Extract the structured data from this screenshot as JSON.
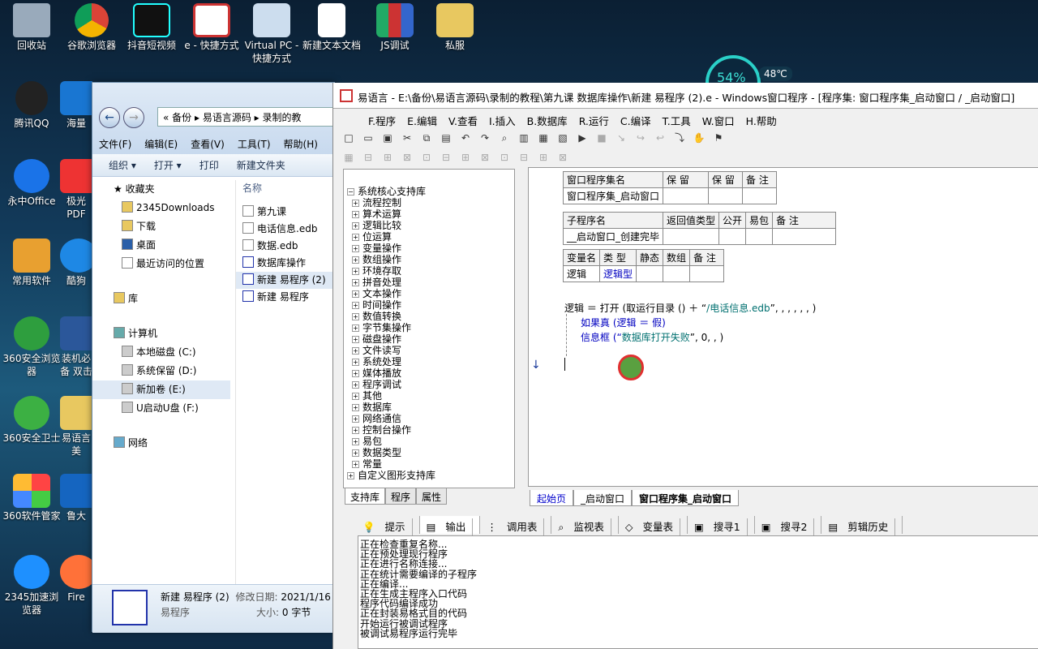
{
  "desktop": {
    "icons": [
      {
        "label": "回收站",
        "icon": "recycle-bin"
      },
      {
        "label": "谷歌浏览器",
        "icon": "chrome"
      },
      {
        "label": "抖音短视频",
        "icon": "douyin"
      },
      {
        "label": "e - 快捷方式",
        "icon": "e-lang"
      },
      {
        "label": "Virtual PC - 快捷方式",
        "icon": "virtual-pc"
      },
      {
        "label": "新建文本文档",
        "icon": "text-file"
      },
      {
        "label": "JS调试",
        "icon": "winrar"
      },
      {
        "label": "私服",
        "icon": "folder"
      },
      {
        "label": "腾讯QQ",
        "icon": "qq"
      },
      {
        "label": "海量",
        "icon": "app"
      },
      {
        "label": "永中Office",
        "icon": "office"
      },
      {
        "label": "极光PDF",
        "icon": "pdf"
      },
      {
        "label": "常用软件",
        "icon": "folder"
      },
      {
        "label": "酷狗",
        "icon": "kugou"
      },
      {
        "label": "360安全浏览器",
        "icon": "browser-360"
      },
      {
        "label": "装机必备 双击",
        "icon": "word"
      },
      {
        "label": "360安全卫士",
        "icon": "guard-360"
      },
      {
        "label": "易语言 美",
        "icon": "folder"
      },
      {
        "label": "360软件管家",
        "icon": "manager-360"
      },
      {
        "label": "鲁大",
        "icon": "app"
      },
      {
        "label": "2345加速浏览器",
        "icon": "ie"
      },
      {
        "label": "Fire",
        "icon": "firefox"
      }
    ],
    "widget": {
      "percent": "54%",
      "temp": "48℃"
    }
  },
  "explorer": {
    "breadcrumb": [
      "«",
      "备份",
      "易语言源码",
      "录制的教"
    ],
    "menu": [
      "文件(F)",
      "编辑(E)",
      "查看(V)",
      "工具(T)",
      "帮助(H)"
    ],
    "toolbar": [
      "组织 ▾",
      "打开 ▾",
      "打印",
      "新建文件夹"
    ],
    "nav": [
      "收藏夹",
      "2345Downloads",
      "下载",
      "桌面",
      "最近访问的位置",
      "库",
      "计算机",
      "本地磁盘 (C:)",
      "系统保留 (D:)",
      "新加卷 (E:)",
      "U启动U盘 (F:)",
      "网络"
    ],
    "column": "名称",
    "files": [
      "第九课",
      "电话信息.edb",
      "数据.edb",
      "数据库操作",
      "新建 易程序 (2)",
      "新建 易程序"
    ],
    "status": {
      "name": "新建 易程序 (2)",
      "modified_label": "修改日期:",
      "modified": "2021/1/16",
      "type": "易程序",
      "size_label": "大小:",
      "size": "0 字节"
    }
  },
  "ide": {
    "title": "易语言 - E:\\备份\\易语言源码\\录制的教程\\第九课 数据库操作\\新建 易程序 (2).e - Windows窗口程序 - [程序集: 窗口程序集_启动窗口 / _启动窗口]",
    "menu": [
      "F.程序",
      "E.编辑",
      "V.查看",
      "I.插入",
      "B.数据库",
      "R.运行",
      "C.编译",
      "T.工具",
      "W.窗口",
      "H.帮助"
    ],
    "tree": [
      "系统核心支持库",
      "流程控制",
      "算术运算",
      "逻辑比较",
      "位运算",
      "变量操作",
      "数组操作",
      "环境存取",
      "拼音处理",
      "文本操作",
      "时间操作",
      "数值转换",
      "字节集操作",
      "磁盘操作",
      "文件读写",
      "系统处理",
      "媒体播放",
      "程序调试",
      "其他",
      "数据库",
      "网络通信",
      "控制台操作",
      "易包",
      "数据类型",
      "常量",
      "自定义图形支持库"
    ],
    "panel_tabs": [
      "支持库",
      "程序",
      "属性"
    ],
    "t1": {
      "h": [
        "窗口程序集名",
        "保 留",
        "保 留",
        "备 注"
      ],
      "r": [
        "窗口程序集_启动窗口",
        "",
        "",
        ""
      ]
    },
    "t2": {
      "h": [
        "子程序名",
        "返回值类型",
        "公开",
        "易包",
        "备 注"
      ],
      "r": [
        "__启动窗口_创建完毕",
        "",
        "",
        "",
        ""
      ]
    },
    "t3": {
      "h": [
        "变量名",
        "类 型",
        "静态",
        "数组",
        "备 注"
      ],
      "r": [
        "逻辑",
        "逻辑型",
        "",
        "",
        ""
      ]
    },
    "code": {
      "l1a": "逻辑 ＝ 打开 (取运行目录 () ＋ “",
      "l1s": "/电话信息.edb",
      "l1b": "”, , , , , , )",
      "l2": "如果真 (逻辑 ＝ 假)",
      "l3a": "信息框 (“",
      "l3s": "数据库打开失败",
      "l3b": "”, 0, , )"
    },
    "editor_tabs": [
      "起始页",
      "_启动窗口",
      "窗口程序集_启动窗口"
    ],
    "output_tabs": [
      "提示",
      "输出",
      "调用表",
      "监视表",
      "变量表",
      "搜寻1",
      "搜寻2",
      "剪辑历史"
    ],
    "output": [
      "正在检查重复名称...",
      "正在预处理现行程序",
      "正在进行名称连接...",
      "正在统计需要编译的子程序",
      "正在编译...",
      "正在生成主程序入口代码",
      "程序代码编译成功",
      "正在封装易格式目的代码",
      "开始运行被调试程序",
      "被调试易程序运行完毕"
    ]
  },
  "colors": {
    "accent": "#0000c0",
    "string": "#007070"
  }
}
